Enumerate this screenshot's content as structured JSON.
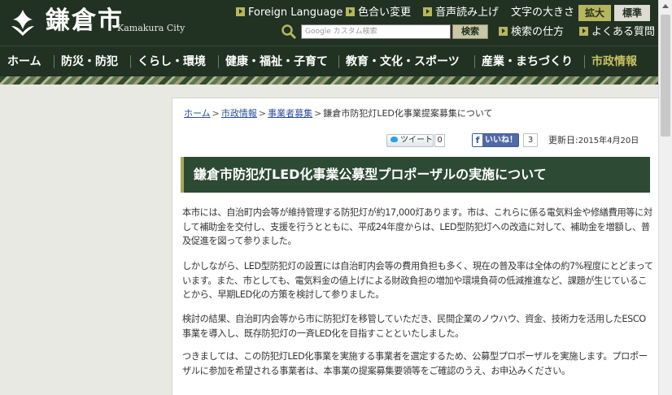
{
  "header": {
    "logo_text": "鎌倉市",
    "logo_sub": "Kamakura City",
    "utility_links": [
      {
        "label": "Foreign Language"
      },
      {
        "label": "色合い変更"
      },
      {
        "label": "音声読み上げ"
      },
      {
        "label": "検索の仕方"
      },
      {
        "label": "よくある質問"
      }
    ],
    "font_size_label": "文字の大きさ",
    "font_large_label": "拡大",
    "font_standard_label": "標準",
    "search": {
      "placeholder": "Google カスタム検索",
      "button_label": "検索"
    }
  },
  "nav": {
    "items": [
      {
        "label": "ホーム"
      },
      {
        "label": "防災・防犯"
      },
      {
        "label": "くらし・環境"
      },
      {
        "label": "健康・福祉・子育て"
      },
      {
        "label": "教育・文化・スポーツ"
      },
      {
        "label": "産業・まちづくり"
      },
      {
        "label": "市政情報"
      }
    ]
  },
  "breadcrumb": {
    "items": [
      "ホーム",
      "市政情報",
      "事業者募集"
    ],
    "current": "鎌倉市防犯灯LED化事業提案募集について"
  },
  "social": {
    "tweet_label": "ツイート",
    "tweet_count": "0",
    "like_icon": "f",
    "like_label": "いいね！",
    "like_count": "3"
  },
  "updated": {
    "label": "更新日:",
    "value": "2015年4月20日"
  },
  "article": {
    "title": "鎌倉市防犯灯LED化事業公募型プロポーザルの実施について",
    "paragraphs": [
      "本市には、自治町内会等が維持管理する防犯灯が約17,000灯あります。市は、これらに係る電気料金や修繕費用等に対して補助金を交付し、支援を行うとともに、平成24年度からは、LED型防犯灯への改造に対して、補助金を増額し、普及促進を図って参りました。",
      "しかしながら、LED型防犯灯の設置には自治町内会等の費用負担も多く、現在の普及率は全体の約7%程度にとどまっています。また、市としても、電気料金の値上げによる財政負担の増加や環境負荷の低減推進など、課題が生じていることから、早期LED化の方策を検討して参りました。",
      "検討の結果、自治町内会等から市に防犯灯を移管していただき、民間企業のノウハウ、資金、技術力を活用したESCO事業を導入し、既存防犯灯の一斉LED化を目指すことといたしました。",
      "つきましては、この防犯灯LED化事業を実施する事業者を選定するため、公募型プロポーザルを実施します。プロポーザルに参加を希望される事業者は、本事業の提案募集要領等をご確認のうえ、お申込みください。"
    ]
  },
  "colors": {
    "header_bg": "#213122",
    "accent": "#b7b55d",
    "title_bg": "#2d4a34",
    "link": "#2a4f9a"
  }
}
